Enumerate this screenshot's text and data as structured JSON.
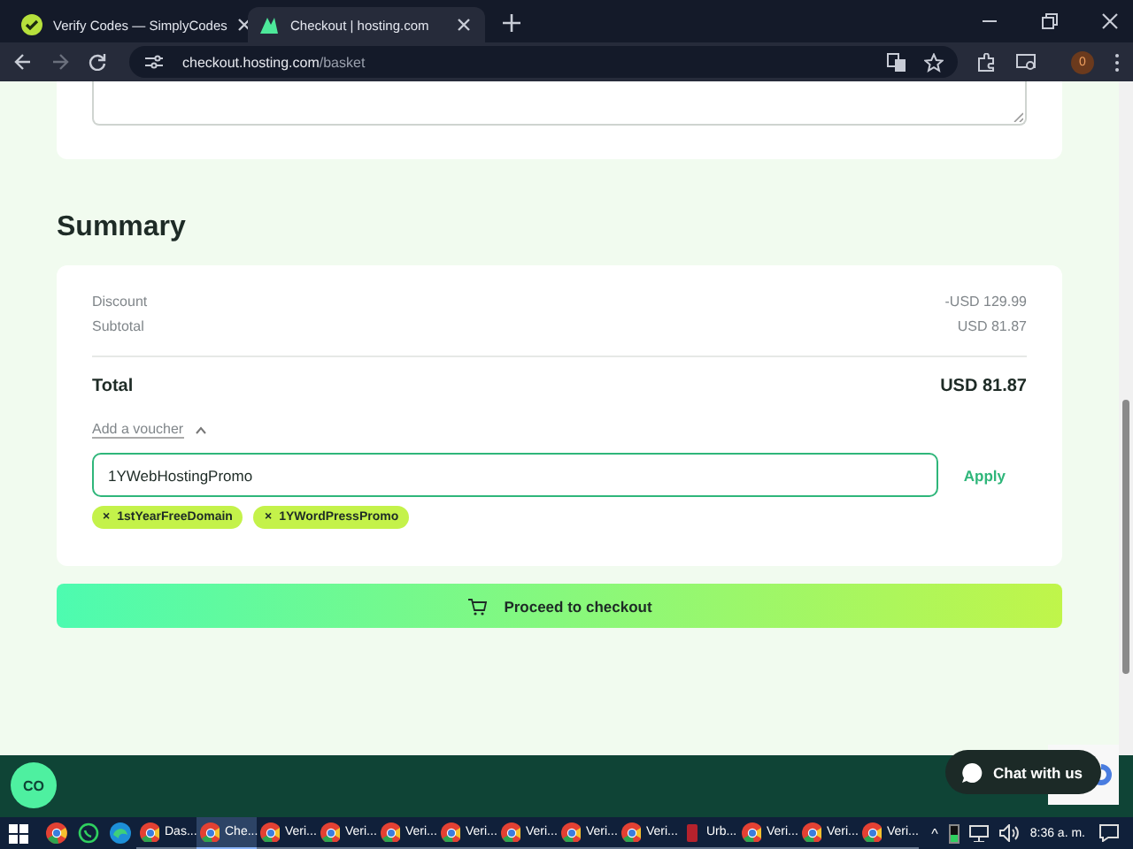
{
  "browser": {
    "tabs": [
      {
        "title": "Verify Codes — SimplyCodes",
        "selected": false,
        "kind": "simply"
      },
      {
        "title": "Checkout | hosting.com",
        "selected": true,
        "kind": "hosting"
      }
    ],
    "url_host": "checkout.hosting.com",
    "url_path": "/basket",
    "extension_badge": "0"
  },
  "summary": {
    "heading": "Summary",
    "lines": [
      {
        "label": "Discount",
        "value": "-USD 129.99"
      },
      {
        "label": "Subtotal",
        "value": "USD 81.87"
      }
    ],
    "total": {
      "label": "Total",
      "value": "USD 81.87"
    },
    "voucher_toggle": {
      "label": "Add a voucher",
      "expanded": true
    },
    "voucher_input": {
      "value": "1YWebHostingPromo"
    },
    "apply_button": "Apply",
    "applied_vouchers": [
      {
        "code": "1stYearFreeDomain",
        "remove": "×"
      },
      {
        "code": "1YWordPressPromo",
        "remove": "×"
      }
    ],
    "checkout_button": "Proceed to checkout"
  },
  "footer": {
    "logo": "CO",
    "chat_button": "Chat with us"
  },
  "taskbar": {
    "pinned": [
      {
        "kind": "chrome"
      },
      {
        "kind": "whatsapp"
      },
      {
        "kind": "edge"
      }
    ],
    "items": [
      {
        "label": "Das...",
        "selected": false,
        "kind": "chrome"
      },
      {
        "label": "Che...",
        "selected": true,
        "kind": "chrome"
      },
      {
        "label": "Veri...",
        "selected": false,
        "kind": "chrome"
      },
      {
        "label": "Veri...",
        "selected": false,
        "kind": "chrome"
      },
      {
        "label": "Veri...",
        "selected": false,
        "kind": "chrome"
      },
      {
        "label": "Veri...",
        "selected": false,
        "kind": "chrome"
      },
      {
        "label": "Veri...",
        "selected": false,
        "kind": "chrome"
      },
      {
        "label": "Veri...",
        "selected": false,
        "kind": "chrome"
      },
      {
        "label": "Veri...",
        "selected": false,
        "kind": "chrome"
      },
      {
        "label": "Urb...",
        "selected": false,
        "kind": "app"
      },
      {
        "label": "Veri...",
        "selected": false,
        "kind": "chrome"
      },
      {
        "label": "Veri...",
        "selected": false,
        "kind": "chrome"
      },
      {
        "label": "Veri...",
        "selected": false,
        "kind": "chrome"
      }
    ],
    "tray_caret": "^",
    "clock": "8:36 a. m."
  }
}
